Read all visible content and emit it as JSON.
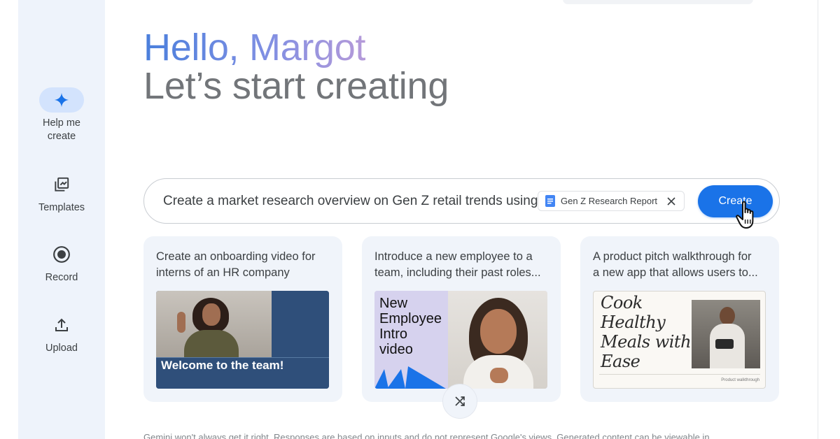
{
  "sidebar": {
    "items": [
      {
        "label_line1": "Help me",
        "label_line2": "create",
        "icon": "sparkle-icon",
        "active": true
      },
      {
        "label": "Templates",
        "icon": "templates-icon"
      },
      {
        "label": "Record",
        "icon": "record-icon"
      },
      {
        "label": "Upload",
        "icon": "upload-icon"
      }
    ]
  },
  "greeting": {
    "hello": "Hello, Margot",
    "subtitle": "Let’s start creating"
  },
  "prompt": {
    "text": "Create a market research overview on Gen Z retail trends using",
    "chip_label": "Gen Z Research Report",
    "chip_icon": "doc-icon",
    "create_label": "Create"
  },
  "suggestions": [
    {
      "line1": "Create an onboarding video for",
      "line2": "interns of an HR company",
      "thumb_caption": "Welcome to the team!"
    },
    {
      "line1": "Introduce a new employee to a",
      "line2": "team, including their past roles...",
      "thumb_lines": [
        "New",
        "Employee",
        "Intro",
        "video"
      ]
    },
    {
      "line1": "A product pitch walkthrough for",
      "line2": "a new app that allows users to...",
      "thumb_lines": [
        "Cook",
        "Healthy",
        "Meals with",
        "Ease"
      ],
      "thumb_footer": "Product walkthrough"
    }
  ],
  "shuffle_icon": "shuffle-icon",
  "disclaimer": "Gemini won't always get it right. Responses are based on inputs and do not represent Google's views. Generated content can be viewable in",
  "colors": {
    "accent": "#1a73e8",
    "sidebar_bg": "#eef3fb",
    "card_bg": "#f0f4fa",
    "active_pill": "#d3e3fd"
  }
}
